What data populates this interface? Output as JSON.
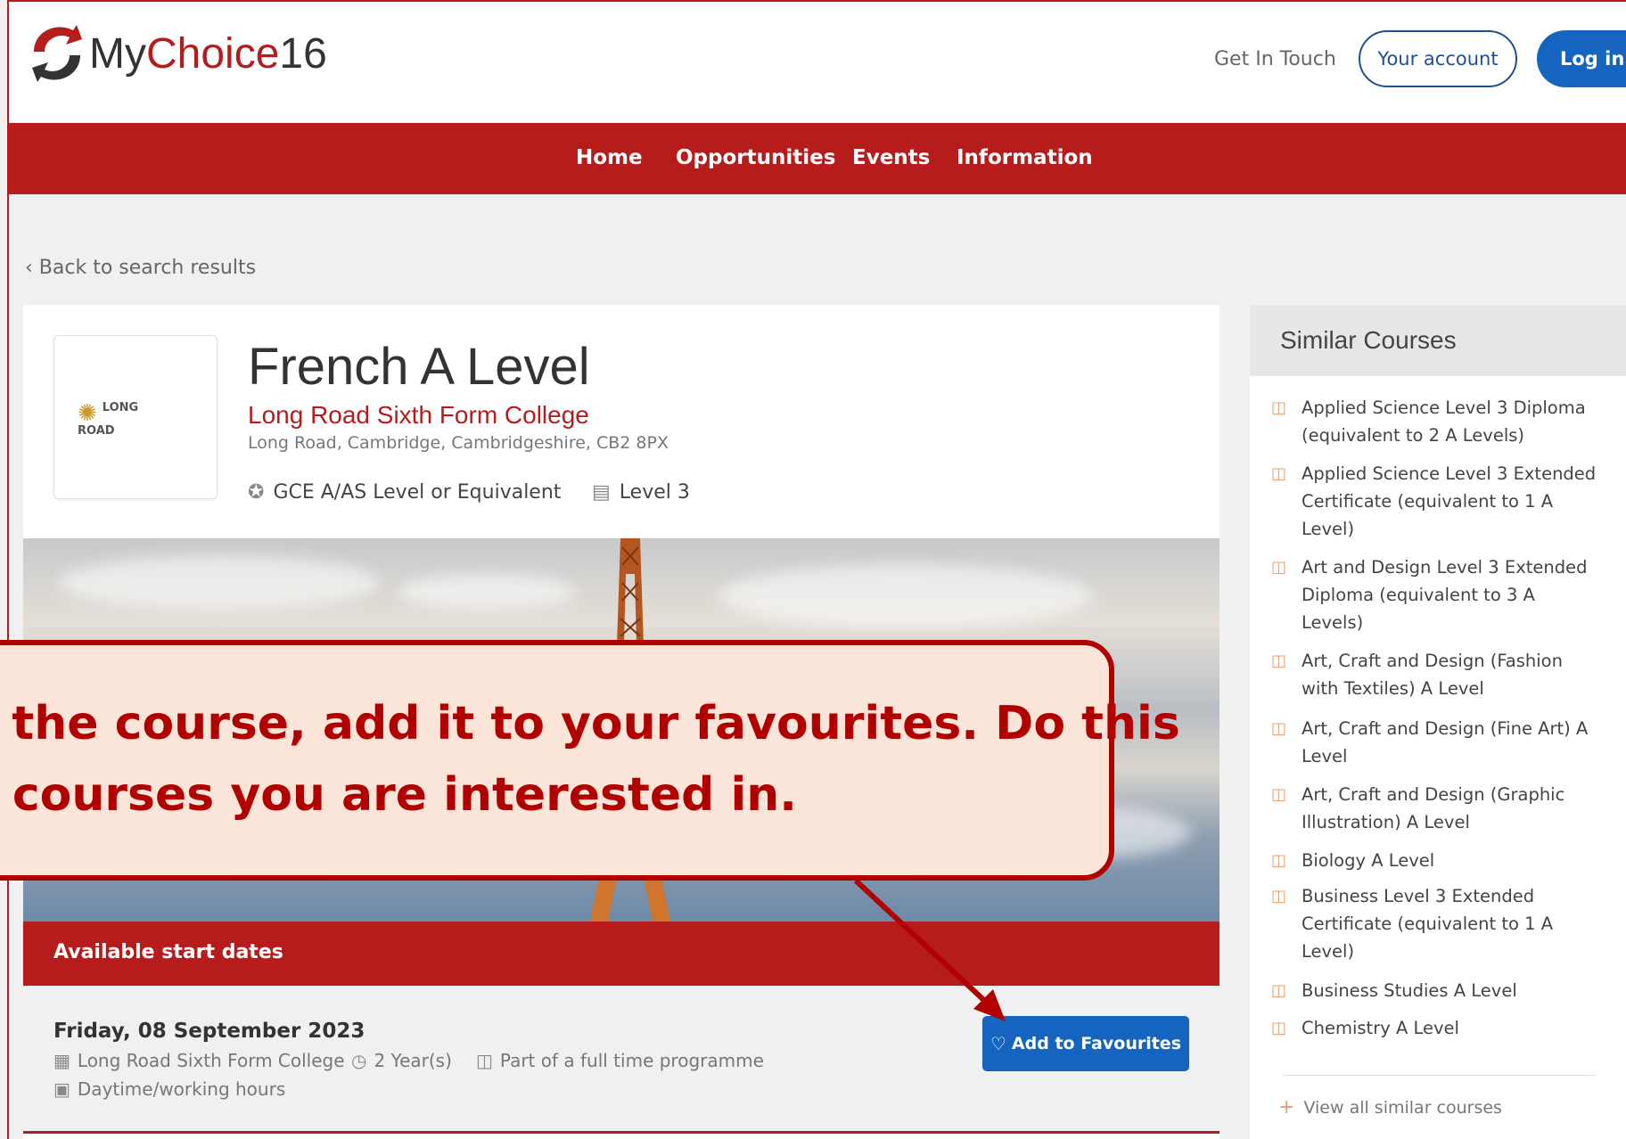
{
  "header": {
    "logo_text_prefix": "My",
    "logo_text_main": "Choice",
    "logo_text_suffix": "16",
    "get_in_touch": "Get In Touch",
    "your_account": "Your account",
    "log_in": "Log in"
  },
  "nav": {
    "items": [
      {
        "label": "Home"
      },
      {
        "label": "Opportunities"
      },
      {
        "label": "Events"
      },
      {
        "label": "Information"
      }
    ]
  },
  "back_link": "Back to search results",
  "course": {
    "title": "French A Level",
    "college": "Long Road Sixth Form College",
    "address": "Long Road, Cambridge, Cambridgeshire, CB2 8PX",
    "qualification": "GCE A/AS Level or Equivalent",
    "level": "Level 3",
    "logo_line1": "LONG",
    "logo_line2": "ROAD"
  },
  "start_dates": {
    "header": "Available start dates",
    "entry": {
      "date": "Friday, 08 September 2023",
      "location": "Long Road Sixth Form College",
      "duration": "2 Year(s)",
      "programme": "Part of a full time programme",
      "hours": "Daytime/working hours",
      "add_favourites": "Add to Favourites"
    }
  },
  "callout": {
    "line1": "e the course, add it to your favourites.  Do this",
    "line2": "o courses you are interested in."
  },
  "similar": {
    "title": "Similar Courses",
    "items": [
      {
        "label": "Applied Science Level 3 Diploma (equivalent to 2 A Levels)"
      },
      {
        "label": "Applied Science Level 3 Extended Certificate (equivalent to 1 A Level)"
      },
      {
        "label": "Art and Design Level 3 Extended Diploma (equivalent to 3 A Levels)"
      },
      {
        "label": "Art, Craft and Design (Fashion with Textiles) A Level"
      },
      {
        "label": "Art, Craft and Design (Fine Art) A Level"
      },
      {
        "label": "Art, Craft and Design (Graphic Illustration) A Level"
      },
      {
        "label": "Biology A Level"
      },
      {
        "label": "Business Level 3 Extended Certificate (equivalent to 1 A Level)"
      },
      {
        "label": "Business Studies A Level"
      },
      {
        "label": "Chemistry A Level"
      }
    ],
    "view_all": "View all similar courses"
  },
  "icons": {
    "logo": "swirl-arrows-logo",
    "qualification": "award-icon",
    "level": "document-icon",
    "location": "building-icon",
    "duration": "clock-icon",
    "programme": "book-icon",
    "hours": "calendar-icon",
    "favourite": "heart-icon",
    "similar_item": "book-icon"
  },
  "colors": {
    "brand_red": "#b71c1c",
    "button_blue": "#1565c0",
    "callout_bg": "#fbe4d8",
    "callout_border": "#b00000"
  }
}
